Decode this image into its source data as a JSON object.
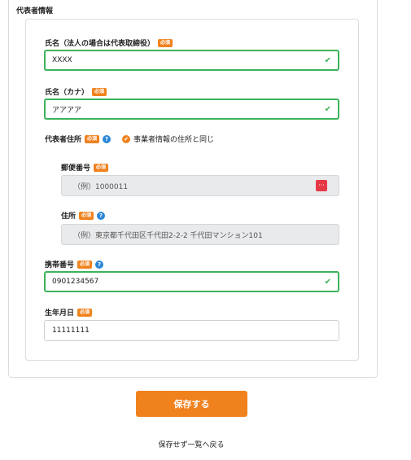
{
  "section": {
    "title": "代表者情報"
  },
  "fields": {
    "name": {
      "label": "氏名（法人の場合は代表取締役）",
      "required": "必須",
      "value": "XXXX"
    },
    "kana": {
      "label": "氏名（カナ）",
      "required": "必須",
      "value": "アアアア"
    },
    "address_section": {
      "label": "代表者住所",
      "required": "必須",
      "help": "?",
      "same_as_business": "事業者情報の住所と同じ"
    },
    "postal": {
      "label": "郵便番号",
      "required": "必須",
      "placeholder": "（例）1000011",
      "button_icon": "···"
    },
    "address": {
      "label": "住所",
      "required": "必須",
      "help": "?",
      "placeholder": "（例）東京都千代田区千代田2-2-2 千代田マンション101"
    },
    "mobile": {
      "label": "携帯番号",
      "required": "必須",
      "help": "?",
      "value": "0901234567"
    },
    "birthday": {
      "label": "生年月日",
      "required": "必須",
      "value": "11111111"
    }
  },
  "icons": {
    "check": "✔",
    "same_check": "✔"
  },
  "actions": {
    "save_label": "保存する",
    "back_label": "保存せず一覧へ戻る"
  },
  "colors": {
    "accent": "#f0821e",
    "valid": "#3cb35a",
    "help": "#2b86d6",
    "postal_button": "#e63946"
  }
}
